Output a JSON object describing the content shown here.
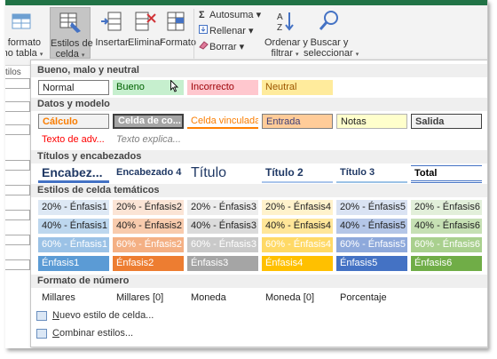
{
  "ribbon": {
    "format_table": {
      "line1": "r formato",
      "line2": "mo tabla"
    },
    "cell_styles": {
      "line1": "Estilos de",
      "line2": "celda"
    },
    "insert": "Insertar",
    "delete": "Eliminar",
    "format": "Formato",
    "autosum": "Autosuma",
    "fill": "Rellenar",
    "clear": "Borrar",
    "sort": {
      "line1": "Ordenar y",
      "line2": "filtrar"
    },
    "find": {
      "line1": "Buscar y",
      "line2": "seleccionar"
    },
    "caret": "▾",
    "sigma": "Σ",
    "left_fragment": "tilos"
  },
  "gallery": {
    "sections": {
      "good_bad": "Bueno, malo y neutral",
      "data_model": "Datos y modelo",
      "titles": "Títulos y encabezados",
      "themed": "Estilos de celda temáticos",
      "number": "Formato de número"
    },
    "good_bad": [
      {
        "label": "Normal",
        "bg": "#ffffff",
        "fg": "#222222"
      },
      {
        "label": "Bueno",
        "bg": "#c6efce",
        "fg": "#006100"
      },
      {
        "label": "Incorrecto",
        "bg": "#ffc7ce",
        "fg": "#9c0006"
      },
      {
        "label": "Neutral",
        "bg": "#ffeb9c",
        "fg": "#9c5700"
      }
    ],
    "data_model_row1": [
      {
        "label": "Cálculo",
        "bg": "#f2f2f2",
        "fg": "#fa7d00"
      },
      {
        "label": "Celda de co...",
        "bg": "#a5a5a5",
        "fg": "#ffffff"
      },
      {
        "label": "Celda vinculada",
        "bg": "#ffffff",
        "fg": "#fa7d00"
      },
      {
        "label": "Entrada",
        "bg": "#ffcc99",
        "fg": "#3f3f76"
      },
      {
        "label": "Notas",
        "bg": "#ffffcc",
        "fg": "#222222"
      },
      {
        "label": "Salida",
        "bg": "#f2f2f2",
        "fg": "#3f3f3f"
      }
    ],
    "data_model_row2": [
      {
        "label": "Texto de adv...",
        "fg": "#ff0000"
      },
      {
        "label": "Texto explica...",
        "fg": "#7f7f7f"
      }
    ],
    "titles": [
      {
        "label": "Encabez...",
        "fg": "#1f3864"
      },
      {
        "label": "Encabezado 4",
        "fg": "#1f3864"
      },
      {
        "label": "Título",
        "fg": "#1f3864"
      },
      {
        "label": "Título 2",
        "fg": "#1f3864"
      },
      {
        "label": "Título 3",
        "fg": "#1f3864"
      },
      {
        "label": "Total",
        "fg": "#000000"
      }
    ],
    "themed_rows": [
      [
        {
          "label": "20% - Énfasis1",
          "bg": "#dde8f4",
          "fg": "#222222"
        },
        {
          "label": "20% - Énfasis2",
          "bg": "#fbe4d5",
          "fg": "#222222"
        },
        {
          "label": "20% - Énfasis3",
          "bg": "#ededed",
          "fg": "#222222"
        },
        {
          "label": "20% - Énfasis4",
          "bg": "#fff2cc",
          "fg": "#222222"
        },
        {
          "label": "20% - Énfasis5",
          "bg": "#dae3f3",
          "fg": "#222222"
        },
        {
          "label": "20% - Énfasis6",
          "bg": "#e2efda",
          "fg": "#222222"
        }
      ],
      [
        {
          "label": "40% - Énfasis1",
          "bg": "#bdd7ee",
          "fg": "#222222"
        },
        {
          "label": "40% - Énfasis2",
          "bg": "#f8cbad",
          "fg": "#222222"
        },
        {
          "label": "40% - Énfasis3",
          "bg": "#dbdbdb",
          "fg": "#222222"
        },
        {
          "label": "40% - Énfasis4",
          "bg": "#ffe699",
          "fg": "#222222"
        },
        {
          "label": "40% - Énfasis5",
          "bg": "#b4c6e7",
          "fg": "#222222"
        },
        {
          "label": "40% - Énfasis6",
          "bg": "#c6e0b4",
          "fg": "#222222"
        }
      ],
      [
        {
          "label": "60% - Énfasis1",
          "bg": "#9bc2e6",
          "fg": "#ffffff"
        },
        {
          "label": "60% - Énfasis2",
          "bg": "#f4b084",
          "fg": "#ffffff"
        },
        {
          "label": "60% - Énfasis3",
          "bg": "#c9c9c9",
          "fg": "#ffffff"
        },
        {
          "label": "60% - Énfasis4",
          "bg": "#ffd966",
          "fg": "#ffffff"
        },
        {
          "label": "60% - Énfasis5",
          "bg": "#8ea9db",
          "fg": "#ffffff"
        },
        {
          "label": "60% - Énfasis6",
          "bg": "#a9d08e",
          "fg": "#ffffff"
        }
      ],
      [
        {
          "label": "Énfasis1",
          "bg": "#5b9bd5",
          "fg": "#ffffff"
        },
        {
          "label": "Énfasis2",
          "bg": "#ed7d31",
          "fg": "#ffffff"
        },
        {
          "label": "Énfasis3",
          "bg": "#a5a5a5",
          "fg": "#ffffff"
        },
        {
          "label": "Énfasis4",
          "bg": "#ffc000",
          "fg": "#ffffff"
        },
        {
          "label": "Énfasis5",
          "bg": "#4472c4",
          "fg": "#ffffff"
        },
        {
          "label": "Énfasis6",
          "bg": "#70ad47",
          "fg": "#ffffff"
        }
      ]
    ],
    "number": [
      "Millares",
      "Millares [0]",
      "Moneda",
      "Moneda [0]",
      "Porcentaje"
    ],
    "menu": {
      "new_style": {
        "accel": "N",
        "rest": "uevo estilo de celda..."
      },
      "merge": {
        "accel": "C",
        "rest": "ombinar estilos..."
      }
    }
  },
  "colors": {
    "ribbon_accent": "#217346",
    "title_underline": "#4472c4"
  }
}
